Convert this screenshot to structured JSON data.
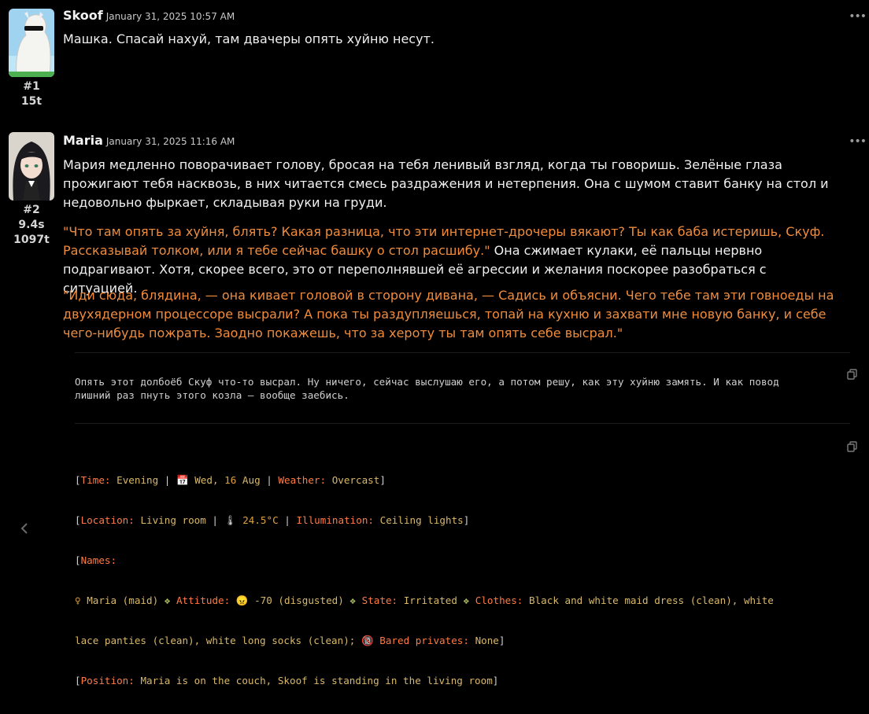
{
  "messages": [
    {
      "author": "Skoof",
      "date": "January 31, 2025 10:57 AM",
      "index": "#1",
      "tokens": "15t",
      "text": "Машка. Спасай нахуй, там двачеры опять хуйню несут."
    },
    {
      "author": "Maria",
      "date": "January 31, 2025 11:16 AM",
      "index": "#2",
      "time": "9.4s",
      "tokens": "1097t",
      "para1": "Мария медленно поворачивает голову, бросая на тебя ленивый взгляд, когда ты говоришь. Зелёные глаза прожигают тебя насквозь, в них читается смесь раздражения и нетерпения. Она с шумом ставит банку на стол и недовольно фыркает, складывая руки на груди.",
      "para2_quote": "\"Что там опять за хуйня, блять? Какая разница, что эти интернет-дрочеры вякают? Ты как баба истеришь, Скуф. Рассказывай толком, или я тебе сейчас башку о стол расшибу.\"",
      "para2_rest": " Она сжимает кулаки, её пальцы нервно подрагивают. Хотя, скорее всего, это от переполнявшей её агрессии и желания поскорее разобраться с ситуацией.",
      "para3_quote": "\"Иди сюда, блядина, — она кивает головой в сторону дивана, — Садись и объясни. Чего тебе там эти говноеды на двухядерном процессоре высрали? А пока ты раздупляешься, топай на кухню и захвати мне новую банку, и себе чего-нибудь пожрать. Заодно покажешь, что за хероту ты там опять себе высрал.\"",
      "thought": "Опять этот долбоёб Скуф что-то высрал. Ну ничего, сейчас выслушаю его, а потом решу, как эту хуйню замять. И как повод\nлишний раз пнуть этого козла — вообще заебись.",
      "status": {
        "time_label": "Time:",
        "time_value": "Evening",
        "day": "Wed,",
        "date_num": "16",
        "date_month": "Aug",
        "weather_label": "Weather:",
        "weather_value": "Overcast",
        "location_label": "Location:",
        "location_value": "Living room",
        "temp": "24.5°C",
        "illum_label": "Illumination:",
        "illum_value": "Ceiling lights",
        "names_label": "Names:",
        "char_name": "Maria (maid)",
        "attitude_label": "Attitude:",
        "attitude_value": "-70 (disgusted)",
        "state_label": "State:",
        "state_value": "Irritated",
        "clothes_label": "Clothes:",
        "clothes_value_1": "Black and white maid dress (clean), white",
        "clothes_value_2": "lace panties (clean), white long socks (clean);",
        "bared_label": "Bared privates:",
        "bared_value": "None",
        "position_label": "Position:",
        "position_value": "Maria is on the couch, Skoof is standing in the living room"
      }
    }
  ],
  "icons": {
    "more": "more-options-icon",
    "copy": "copy-icon",
    "calendar": "calendar-icon",
    "thermometer": "thermometer-icon",
    "female": "female-icon",
    "angry_face": "angry-face-icon",
    "no_18": "no-18-icon",
    "collapse": "chevron-left-icon"
  },
  "colors": {
    "background": "#000000",
    "quote": "#f08c3c",
    "status_label": "#ff7a45",
    "status_value": "#d8b86a"
  }
}
